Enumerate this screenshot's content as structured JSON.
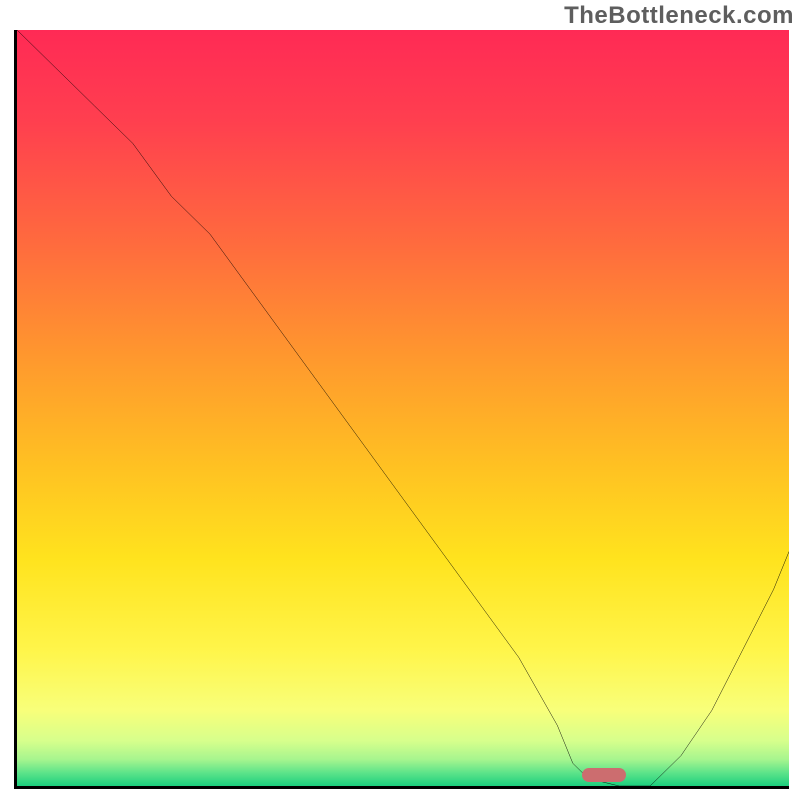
{
  "watermark": "TheBottleneck.com",
  "chart_data": {
    "type": "line",
    "title": "",
    "xlabel": "",
    "ylabel": "",
    "xlim": [
      0,
      100
    ],
    "ylim": [
      0,
      100
    ],
    "grid": false,
    "legend": false,
    "series": [
      {
        "name": "curve",
        "x": [
          0,
          5,
          10,
          15,
          20,
          25,
          30,
          35,
          40,
          45,
          50,
          55,
          60,
          65,
          70,
          72,
          74,
          78,
          82,
          86,
          90,
          94,
          98,
          100
        ],
        "values": [
          100,
          95,
          90,
          85,
          78,
          73,
          66,
          59,
          52,
          45,
          38,
          31,
          24,
          17,
          8,
          3,
          1,
          0,
          0,
          4,
          10,
          18,
          26,
          31
        ]
      }
    ],
    "marker": {
      "x_center": 76,
      "y": 1,
      "width": 6
    },
    "background_gradient": {
      "stops": [
        {
          "pos": 0.0,
          "color": "#ff2a55"
        },
        {
          "pos": 0.12,
          "color": "#ff3f4f"
        },
        {
          "pos": 0.28,
          "color": "#ff6a3e"
        },
        {
          "pos": 0.44,
          "color": "#ff9a2d"
        },
        {
          "pos": 0.58,
          "color": "#ffc222"
        },
        {
          "pos": 0.7,
          "color": "#ffe31e"
        },
        {
          "pos": 0.82,
          "color": "#fff54a"
        },
        {
          "pos": 0.9,
          "color": "#f8ff7a"
        },
        {
          "pos": 0.94,
          "color": "#d7ff8c"
        },
        {
          "pos": 0.965,
          "color": "#a6f58e"
        },
        {
          "pos": 0.982,
          "color": "#5fe48a"
        },
        {
          "pos": 1.0,
          "color": "#1ccf7e"
        }
      ]
    }
  }
}
